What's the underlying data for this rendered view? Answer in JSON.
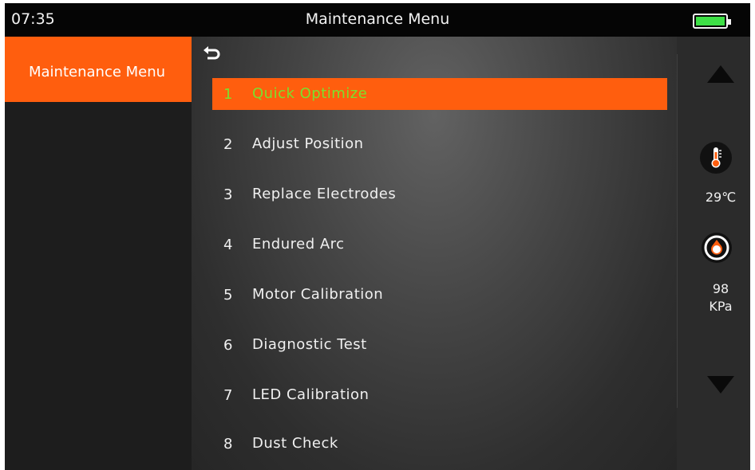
{
  "status_bar": {
    "time": "07:35",
    "title": "Maintenance Menu",
    "battery_color": "#3ee046"
  },
  "sidebar": {
    "items": [
      {
        "label": "Maintenance Menu",
        "selected": true
      }
    ]
  },
  "menu": {
    "back_icon": "back-arrow-icon",
    "items": [
      {
        "num": "1",
        "label": "Quick Optimize",
        "selected": true
      },
      {
        "num": "2",
        "label": "Adjust Position"
      },
      {
        "num": "3",
        "label": "Replace Electrodes"
      },
      {
        "num": "4",
        "label": "Endured Arc"
      },
      {
        "num": "5",
        "label": "Motor Calibration"
      },
      {
        "num": "6",
        "label": "Diagnostic Test"
      },
      {
        "num": "7",
        "label": "LED Calibration"
      },
      {
        "num": "8",
        "label": "Dust Check"
      }
    ]
  },
  "side_panel": {
    "scroll_up_icon": "triangle-up-icon",
    "scroll_down_icon": "triangle-down-icon",
    "temperature": {
      "icon": "thermometer-icon",
      "value": "29℃"
    },
    "pressure": {
      "icon": "gauge-icon",
      "value": "98",
      "unit": "KPa"
    }
  },
  "colors": {
    "accent": "#ff5e0e",
    "selected_text": "#7be02d",
    "topbar": "#050505",
    "sidebar": "#1d1d1d"
  }
}
